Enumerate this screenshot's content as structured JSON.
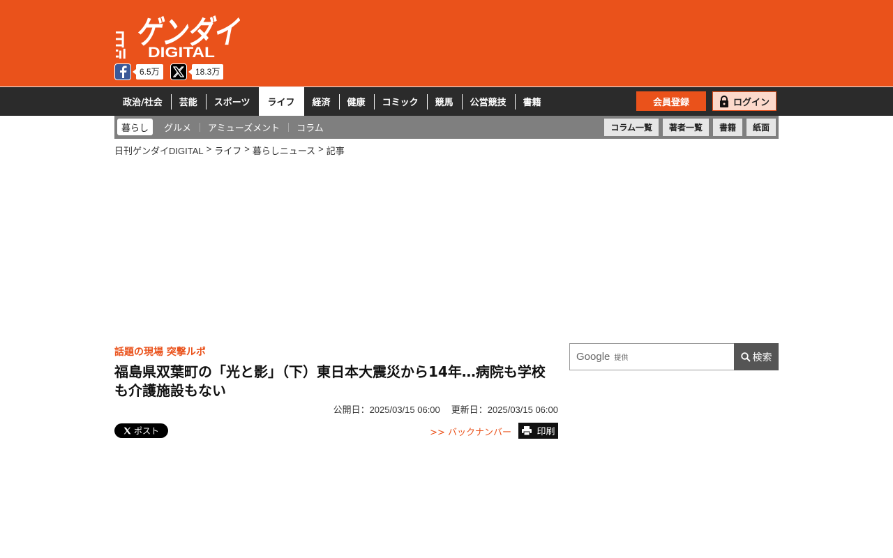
{
  "header": {
    "logo_top": "日刊",
    "logo_main": "ゲンダイ",
    "logo_sub": "DIGITAL",
    "facebook_count": "6.5万",
    "x_count": "18.3万",
    "facebook_icon": "facebook-icon",
    "x_icon": "x-icon",
    "brand_color": "#ea521b"
  },
  "main_nav": {
    "items": [
      {
        "label": "政治/社会"
      },
      {
        "label": "芸能"
      },
      {
        "label": "スポーツ"
      },
      {
        "label": "ライフ",
        "active": true
      },
      {
        "label": "経済"
      },
      {
        "label": "健康"
      },
      {
        "label": "コミック"
      },
      {
        "label": "競馬"
      },
      {
        "label": "公営競技"
      },
      {
        "label": "書籍"
      }
    ],
    "register_label": "会員登録",
    "login_label": "ログイン",
    "login_icon": "lock-icon"
  },
  "sub_nav": {
    "items": [
      {
        "label": "暮らし",
        "active": true
      },
      {
        "label": "グルメ"
      },
      {
        "label": "アミューズメント"
      },
      {
        "label": "コラム"
      }
    ],
    "right_buttons": [
      {
        "label": "コラム一覧"
      },
      {
        "label": "著者一覧"
      },
      {
        "label": "書籍"
      },
      {
        "label": "紙面"
      }
    ]
  },
  "breadcrumb": {
    "items": [
      "日刊ゲンダイDIGITAL",
      ">",
      "ライフ",
      ">",
      "暮らしニュース",
      ">",
      "記事"
    ]
  },
  "article": {
    "category": "話題の現場 突撃ルポ",
    "title": "福島県双葉町の「光と影」（下）東日本大震災から14年…病院も学校も介護施設もない",
    "published": "公開日：2025/03/15 06:00",
    "updated": "更新日：2025/03/15 06:00",
    "post_label": "ポスト",
    "backnumber_label": ">> バックナンバー",
    "print_label": "印刷"
  },
  "search": {
    "google_label": "Google",
    "provided_label": "提供",
    "button_label": "検索",
    "icon": "search-icon"
  }
}
